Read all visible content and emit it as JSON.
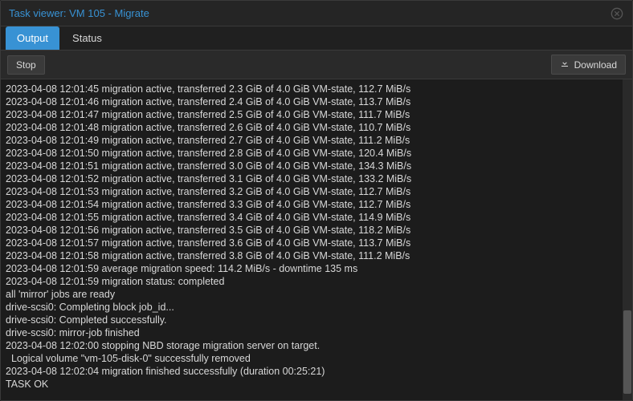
{
  "window": {
    "title": "Task viewer: VM 105 - Migrate"
  },
  "tabs": {
    "output_label": "Output",
    "status_label": "Status"
  },
  "toolbar": {
    "stop_label": "Stop",
    "download_label": "Download"
  },
  "log": {
    "lines": [
      "2023-04-08 12:01:45 migration active, transferred 2.3 GiB of 4.0 GiB VM-state, 112.7 MiB/s",
      "2023-04-08 12:01:46 migration active, transferred 2.4 GiB of 4.0 GiB VM-state, 113.7 MiB/s",
      "2023-04-08 12:01:47 migration active, transferred 2.5 GiB of 4.0 GiB VM-state, 111.7 MiB/s",
      "2023-04-08 12:01:48 migration active, transferred 2.6 GiB of 4.0 GiB VM-state, 110.7 MiB/s",
      "2023-04-08 12:01:49 migration active, transferred 2.7 GiB of 4.0 GiB VM-state, 111.2 MiB/s",
      "2023-04-08 12:01:50 migration active, transferred 2.8 GiB of 4.0 GiB VM-state, 120.4 MiB/s",
      "2023-04-08 12:01:51 migration active, transferred 3.0 GiB of 4.0 GiB VM-state, 134.3 MiB/s",
      "2023-04-08 12:01:52 migration active, transferred 3.1 GiB of 4.0 GiB VM-state, 133.2 MiB/s",
      "2023-04-08 12:01:53 migration active, transferred 3.2 GiB of 4.0 GiB VM-state, 112.7 MiB/s",
      "2023-04-08 12:01:54 migration active, transferred 3.3 GiB of 4.0 GiB VM-state, 112.7 MiB/s",
      "2023-04-08 12:01:55 migration active, transferred 3.4 GiB of 4.0 GiB VM-state, 114.9 MiB/s",
      "2023-04-08 12:01:56 migration active, transferred 3.5 GiB of 4.0 GiB VM-state, 118.2 MiB/s",
      "2023-04-08 12:01:57 migration active, transferred 3.6 GiB of 4.0 GiB VM-state, 113.7 MiB/s",
      "2023-04-08 12:01:58 migration active, transferred 3.8 GiB of 4.0 GiB VM-state, 111.2 MiB/s",
      "2023-04-08 12:01:59 average migration speed: 114.2 MiB/s - downtime 135 ms",
      "2023-04-08 12:01:59 migration status: completed",
      "all 'mirror' jobs are ready",
      "drive-scsi0: Completing block job_id...",
      "drive-scsi0: Completed successfully.",
      "drive-scsi0: mirror-job finished",
      "2023-04-08 12:02:00 stopping NBD storage migration server on target.",
      "  Logical volume \"vm-105-disk-0\" successfully removed",
      "2023-04-08 12:02:04 migration finished successfully (duration 00:25:21)",
      "TASK OK"
    ]
  },
  "scrollbar": {
    "thumb_top_pct": 72,
    "thumb_height_pct": 26
  }
}
